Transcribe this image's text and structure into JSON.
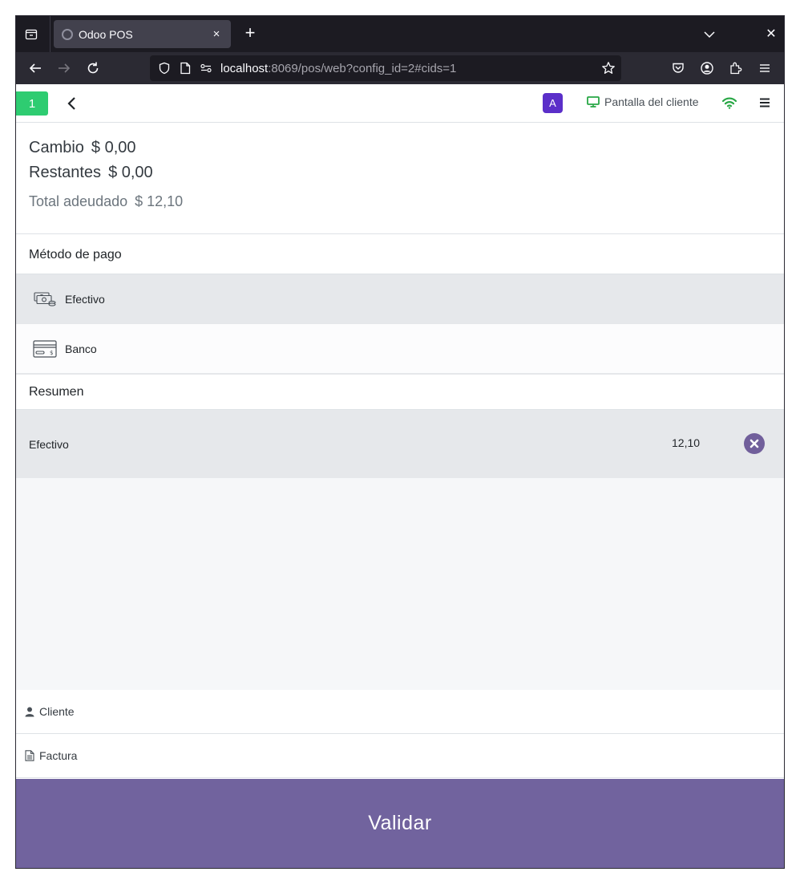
{
  "browser": {
    "tab_title": "Odoo POS",
    "tab_close": "×",
    "new_tab": "+",
    "window_close": "✕",
    "url_host": "localhost",
    "url_rest": ":8069/pos/web?config_id=2#cids=1"
  },
  "pos_header": {
    "order_number": "1",
    "cashier_initial": "A",
    "customer_display_label": "Pantalla del cliente",
    "colors": {
      "order_badge": "#2ecc71",
      "avatar": "#5b2fc9",
      "online": "#28a745",
      "display_icon": "#28a745"
    }
  },
  "payment_status": {
    "change_label": "Cambio",
    "change_value": "$ 0,00",
    "remaining_label": "Restantes",
    "remaining_value": "$ 0,00",
    "total_label": "Total adeudado",
    "total_value": "$ 12,10"
  },
  "methods": {
    "title": "Método de pago",
    "items": [
      {
        "label": "Efectivo",
        "icon": "cash-icon",
        "selected": true
      },
      {
        "label": "Banco",
        "icon": "bank-card-icon",
        "selected": false
      }
    ]
  },
  "summary": {
    "title": "Resumen",
    "lines": [
      {
        "method": "Efectivo",
        "amount": "12,10"
      }
    ]
  },
  "options": {
    "customer_label": "Cliente",
    "invoice_label": "Factura"
  },
  "validate": {
    "label": "Validar",
    "color": "#71639e"
  }
}
